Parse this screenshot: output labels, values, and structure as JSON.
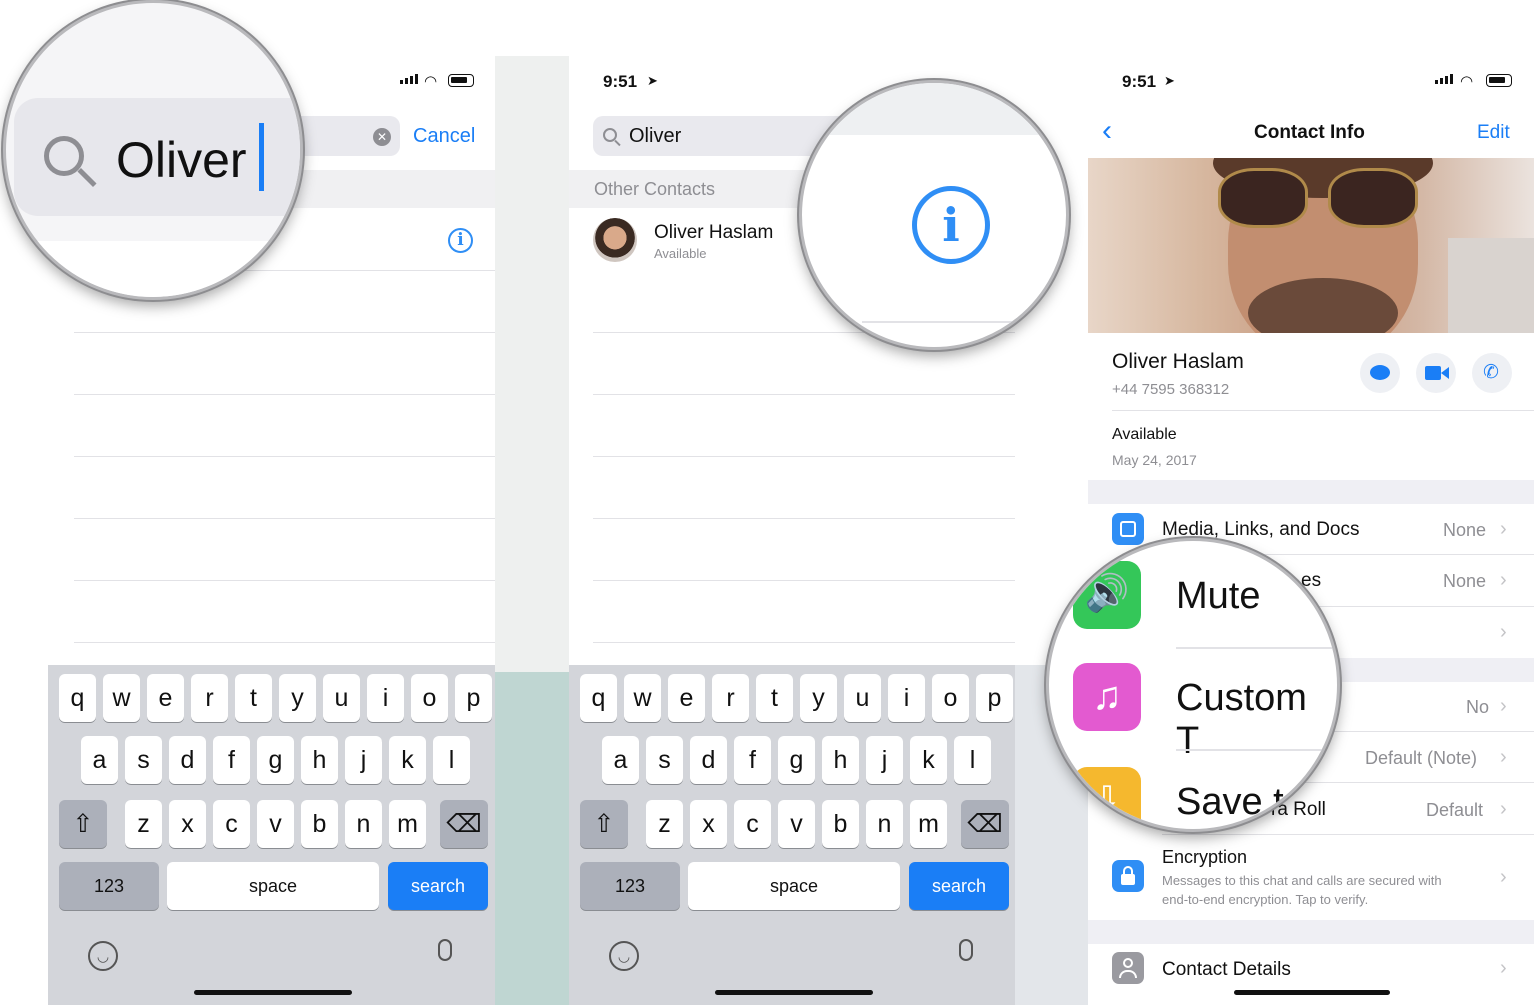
{
  "screen1": {
    "search_value": "Oliver",
    "cancel_label": "Cancel",
    "zoom_text": "Oliver"
  },
  "screen2": {
    "time": "9:51",
    "search_value": "Oliver",
    "section_header": "Other Contacts",
    "contact_name": "Oliver Haslam",
    "contact_status": "Available"
  },
  "keyboard": {
    "row1": [
      "q",
      "w",
      "e",
      "r",
      "t",
      "y",
      "u",
      "i",
      "o",
      "p"
    ],
    "row2": [
      "a",
      "s",
      "d",
      "f",
      "g",
      "h",
      "j",
      "k",
      "l"
    ],
    "row3": [
      "z",
      "x",
      "c",
      "v",
      "b",
      "n",
      "m"
    ],
    "numbers_label": "123",
    "space_label": "space",
    "search_label": "search"
  },
  "screen3": {
    "time": "9:51",
    "nav_title": "Contact Info",
    "edit_label": "Edit",
    "name": "Oliver Haslam",
    "phone": "+44 7595 368312",
    "status": "Available",
    "status_date": "May 24, 2017",
    "rows": [
      {
        "label": "Media, Links, and Docs",
        "value": "None"
      },
      {
        "label": "es",
        "value": "None"
      },
      {
        "label": "",
        "value": ""
      },
      {
        "label": "",
        "value": "No"
      },
      {
        "label": "",
        "value": "Default (Note)"
      },
      {
        "label": "ra Roll",
        "value": "Default"
      }
    ],
    "encryption_title": "Encryption",
    "encryption_desc_1": "Messages to this chat and calls are secured with",
    "encryption_desc_2": "end-to-end encryption. Tap to verify.",
    "contact_details": "Contact Details",
    "zoom": {
      "mute": "Mute",
      "custom": "Custom T",
      "save": "Save t"
    }
  },
  "colors": {
    "accent": "#1a7ef6",
    "keyboard_bg": "#d3d5da",
    "mute_green": "#34c759",
    "custom_pink": "#e35ad0",
    "save_yellow": "#f5b82e"
  }
}
